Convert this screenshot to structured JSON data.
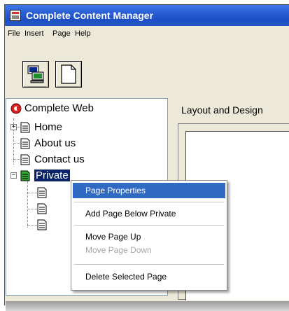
{
  "window": {
    "title": "Complete Content Manager"
  },
  "menubar": {
    "items": [
      "File",
      "Insert",
      "Page",
      "Help"
    ]
  },
  "toolbar": {
    "buttons": [
      "computer-icon",
      "blank-page-icon"
    ]
  },
  "tree": {
    "root": "Complete Web",
    "items": [
      "Home",
      "About us",
      "Contact us",
      "Private"
    ]
  },
  "right_panel": {
    "heading": "Layout and Design"
  },
  "context_menu": {
    "items": [
      "Page Properties",
      "Add Page Below Private",
      "Move Page Up",
      "Move Page Down",
      "Delete Selected Page"
    ]
  },
  "colors": {
    "titlebar": "#2456cc",
    "selection": "#0a246a",
    "highlight": "#316ac5"
  }
}
